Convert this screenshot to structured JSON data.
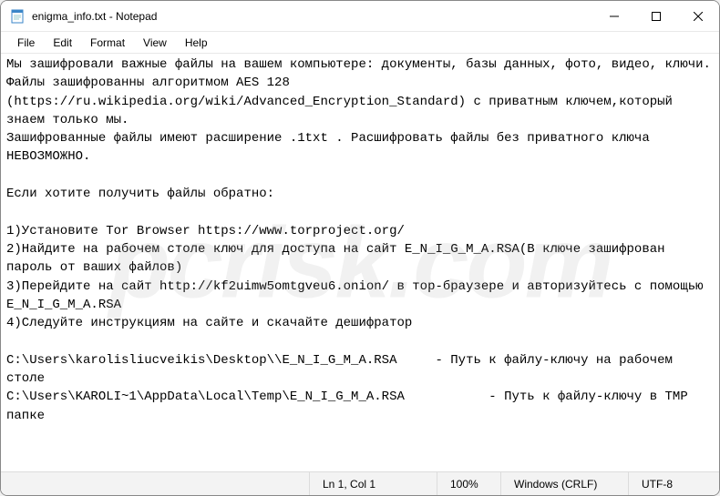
{
  "window": {
    "title": "enigma_info.txt - Notepad",
    "icon": "notepad-icon"
  },
  "menu": {
    "file": "File",
    "edit": "Edit",
    "format": "Format",
    "view": "View",
    "help": "Help"
  },
  "content": {
    "text": "Мы зашифровали важные файлы на вашем компьютере: документы, базы данных, фото, видео, ключи.\nФайлы зашифрованны алгоритмом AES 128 (https://ru.wikipedia.org/wiki/Advanced_Encryption_Standard) с приватным ключем,который знаем только мы.\nЗашифрованные файлы имеют расширение .1txt . Расшифровать файлы без приватного ключа НЕВОЗМОЖНО.\n\nЕсли хотите получить файлы обратно:\n\n1)Установите Tor Browser https://www.torproject.org/\n2)Найдите на рабочем столе ключ для доступа на сайт E_N_I_G_M_A.RSA(В ключе зашифрован пароль от ваших файлов)\n3)Перейдите на сайт http://kf2uimw5omtgveu6.onion/ в тор-браузере и авторизуйтесь с помощью E_N_I_G_M_A.RSA\n4)Следуйте инструкциям на сайте и скачайте дешифратор\n\nC:\\Users\\karolisliucveikis\\Desktop\\\\E_N_I_G_M_A.RSA     - Путь к файлу-ключу на рабочем столе\nC:\\Users\\KAROLI~1\\AppData\\Local\\Temp\\E_N_I_G_M_A.RSA           - Путь к файлу-ключу в TMP папке"
  },
  "status": {
    "position": "Ln 1, Col 1",
    "zoom": "100%",
    "lineending": "Windows (CRLF)",
    "encoding": "UTF-8"
  },
  "watermark": "pcrisk.com"
}
